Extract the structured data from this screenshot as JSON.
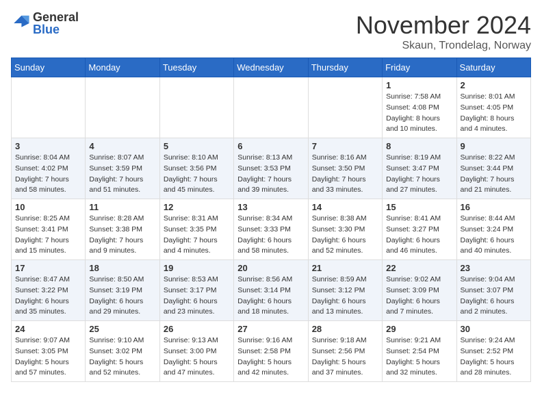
{
  "logo": {
    "general": "General",
    "blue": "Blue"
  },
  "title": "November 2024",
  "location": "Skaun, Trondelag, Norway",
  "weekdays": [
    "Sunday",
    "Monday",
    "Tuesday",
    "Wednesday",
    "Thursday",
    "Friday",
    "Saturday"
  ],
  "weeks": [
    [
      {
        "day": "",
        "info": ""
      },
      {
        "day": "",
        "info": ""
      },
      {
        "day": "",
        "info": ""
      },
      {
        "day": "",
        "info": ""
      },
      {
        "day": "",
        "info": ""
      },
      {
        "day": "1",
        "info": "Sunrise: 7:58 AM\nSunset: 4:08 PM\nDaylight: 8 hours\nand 10 minutes."
      },
      {
        "day": "2",
        "info": "Sunrise: 8:01 AM\nSunset: 4:05 PM\nDaylight: 8 hours\nand 4 minutes."
      }
    ],
    [
      {
        "day": "3",
        "info": "Sunrise: 8:04 AM\nSunset: 4:02 PM\nDaylight: 7 hours\nand 58 minutes."
      },
      {
        "day": "4",
        "info": "Sunrise: 8:07 AM\nSunset: 3:59 PM\nDaylight: 7 hours\nand 51 minutes."
      },
      {
        "day": "5",
        "info": "Sunrise: 8:10 AM\nSunset: 3:56 PM\nDaylight: 7 hours\nand 45 minutes."
      },
      {
        "day": "6",
        "info": "Sunrise: 8:13 AM\nSunset: 3:53 PM\nDaylight: 7 hours\nand 39 minutes."
      },
      {
        "day": "7",
        "info": "Sunrise: 8:16 AM\nSunset: 3:50 PM\nDaylight: 7 hours\nand 33 minutes."
      },
      {
        "day": "8",
        "info": "Sunrise: 8:19 AM\nSunset: 3:47 PM\nDaylight: 7 hours\nand 27 minutes."
      },
      {
        "day": "9",
        "info": "Sunrise: 8:22 AM\nSunset: 3:44 PM\nDaylight: 7 hours\nand 21 minutes."
      }
    ],
    [
      {
        "day": "10",
        "info": "Sunrise: 8:25 AM\nSunset: 3:41 PM\nDaylight: 7 hours\nand 15 minutes."
      },
      {
        "day": "11",
        "info": "Sunrise: 8:28 AM\nSunset: 3:38 PM\nDaylight: 7 hours\nand 9 minutes."
      },
      {
        "day": "12",
        "info": "Sunrise: 8:31 AM\nSunset: 3:35 PM\nDaylight: 7 hours\nand 4 minutes."
      },
      {
        "day": "13",
        "info": "Sunrise: 8:34 AM\nSunset: 3:33 PM\nDaylight: 6 hours\nand 58 minutes."
      },
      {
        "day": "14",
        "info": "Sunrise: 8:38 AM\nSunset: 3:30 PM\nDaylight: 6 hours\nand 52 minutes."
      },
      {
        "day": "15",
        "info": "Sunrise: 8:41 AM\nSunset: 3:27 PM\nDaylight: 6 hours\nand 46 minutes."
      },
      {
        "day": "16",
        "info": "Sunrise: 8:44 AM\nSunset: 3:24 PM\nDaylight: 6 hours\nand 40 minutes."
      }
    ],
    [
      {
        "day": "17",
        "info": "Sunrise: 8:47 AM\nSunset: 3:22 PM\nDaylight: 6 hours\nand 35 minutes."
      },
      {
        "day": "18",
        "info": "Sunrise: 8:50 AM\nSunset: 3:19 PM\nDaylight: 6 hours\nand 29 minutes."
      },
      {
        "day": "19",
        "info": "Sunrise: 8:53 AM\nSunset: 3:17 PM\nDaylight: 6 hours\nand 23 minutes."
      },
      {
        "day": "20",
        "info": "Sunrise: 8:56 AM\nSunset: 3:14 PM\nDaylight: 6 hours\nand 18 minutes."
      },
      {
        "day": "21",
        "info": "Sunrise: 8:59 AM\nSunset: 3:12 PM\nDaylight: 6 hours\nand 13 minutes."
      },
      {
        "day": "22",
        "info": "Sunrise: 9:02 AM\nSunset: 3:09 PM\nDaylight: 6 hours\nand 7 minutes."
      },
      {
        "day": "23",
        "info": "Sunrise: 9:04 AM\nSunset: 3:07 PM\nDaylight: 6 hours\nand 2 minutes."
      }
    ],
    [
      {
        "day": "24",
        "info": "Sunrise: 9:07 AM\nSunset: 3:05 PM\nDaylight: 5 hours\nand 57 minutes."
      },
      {
        "day": "25",
        "info": "Sunrise: 9:10 AM\nSunset: 3:02 PM\nDaylight: 5 hours\nand 52 minutes."
      },
      {
        "day": "26",
        "info": "Sunrise: 9:13 AM\nSunset: 3:00 PM\nDaylight: 5 hours\nand 47 minutes."
      },
      {
        "day": "27",
        "info": "Sunrise: 9:16 AM\nSunset: 2:58 PM\nDaylight: 5 hours\nand 42 minutes."
      },
      {
        "day": "28",
        "info": "Sunrise: 9:18 AM\nSunset: 2:56 PM\nDaylight: 5 hours\nand 37 minutes."
      },
      {
        "day": "29",
        "info": "Sunrise: 9:21 AM\nSunset: 2:54 PM\nDaylight: 5 hours\nand 32 minutes."
      },
      {
        "day": "30",
        "info": "Sunrise: 9:24 AM\nSunset: 2:52 PM\nDaylight: 5 hours\nand 28 minutes."
      }
    ]
  ]
}
